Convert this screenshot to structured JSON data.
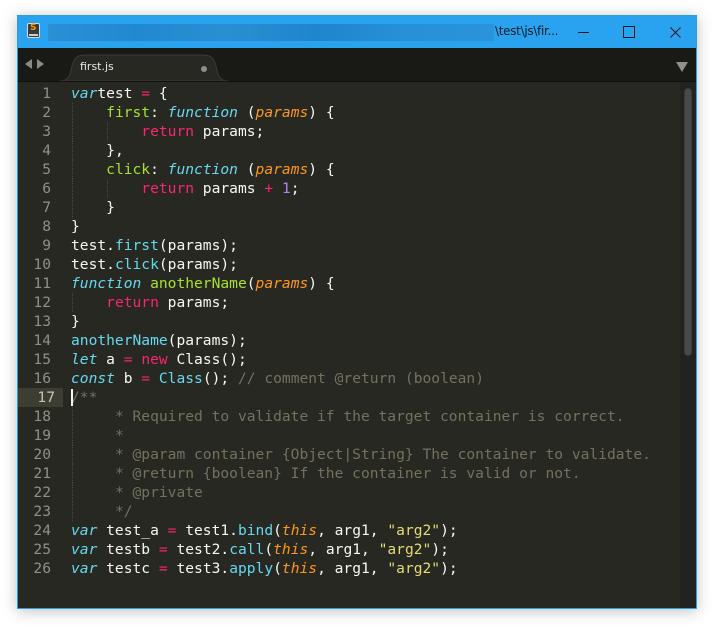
{
  "window": {
    "title_visible": "\\test\\js\\fir...",
    "title_redacted": true,
    "accent_color": "#29a3ef",
    "controls": {
      "minimize_label": "minimize",
      "maximize_label": "maximize",
      "close_label": "close"
    }
  },
  "tabs": [
    {
      "label": "first.js",
      "active": true,
      "dirty": true
    }
  ],
  "editor": {
    "theme": "Monokai",
    "active_line": 17,
    "colors": {
      "background": "#272822",
      "foreground": "#f8f8f2",
      "keyword": "#f92672",
      "storage": "#66d9ef",
      "function": "#a6e22e",
      "parameter": "#fd971f",
      "number": "#ae81ff",
      "string": "#e6db74",
      "comment": "#75715e"
    },
    "lines": [
      {
        "n": "1",
        "indent": 0,
        "tokens": [
          [
            "kw-st",
            "var"
          ],
          [
            "",
            "test "
          ],
          [
            "kw",
            "="
          ],
          [
            "",
            " {"
          ]
        ]
      },
      {
        "n": "2",
        "indent": 1,
        "tokens": [
          [
            "fn",
            "first"
          ],
          [
            "",
            ": "
          ],
          [
            "kw-st",
            "function"
          ],
          [
            "",
            " ("
          ],
          [
            "prm",
            "params"
          ],
          [
            "",
            ") {"
          ]
        ]
      },
      {
        "n": "3",
        "indent": 2,
        "tokens": [
          [
            "kw",
            "return"
          ],
          [
            "",
            " params;"
          ]
        ]
      },
      {
        "n": "4",
        "indent": 1,
        "tokens": [
          [
            "",
            "},"
          ]
        ]
      },
      {
        "n": "5",
        "indent": 1,
        "tokens": [
          [
            "fn",
            "click"
          ],
          [
            "",
            ": "
          ],
          [
            "kw-st",
            "function"
          ],
          [
            "",
            " ("
          ],
          [
            "prm",
            "params"
          ],
          [
            "",
            ") {"
          ]
        ]
      },
      {
        "n": "6",
        "indent": 2,
        "tokens": [
          [
            "kw",
            "return"
          ],
          [
            "",
            " params "
          ],
          [
            "kw",
            "+"
          ],
          [
            "",
            " "
          ],
          [
            "num",
            "1"
          ],
          [
            "",
            ";"
          ]
        ]
      },
      {
        "n": "7",
        "indent": 1,
        "tokens": [
          [
            "",
            "}"
          ]
        ]
      },
      {
        "n": "8",
        "indent": 0,
        "tokens": [
          [
            "",
            "}"
          ]
        ]
      },
      {
        "n": "9",
        "indent": 0,
        "tokens": [
          [
            "",
            "test."
          ],
          [
            "sup",
            "first"
          ],
          [
            "",
            "(params);"
          ]
        ]
      },
      {
        "n": "10",
        "indent": 0,
        "tokens": [
          [
            "",
            "test."
          ],
          [
            "sup",
            "click"
          ],
          [
            "",
            "(params);"
          ]
        ]
      },
      {
        "n": "11",
        "indent": 0,
        "tokens": [
          [
            "kw-st",
            "function"
          ],
          [
            "",
            " "
          ],
          [
            "fn",
            "anotherName"
          ],
          [
            "",
            "("
          ],
          [
            "prm",
            "params"
          ],
          [
            "",
            ") {"
          ]
        ]
      },
      {
        "n": "12",
        "indent": 1,
        "tokens": [
          [
            "kw",
            "return"
          ],
          [
            "",
            " params;"
          ]
        ]
      },
      {
        "n": "13",
        "indent": 0,
        "tokens": [
          [
            "",
            "}"
          ]
        ]
      },
      {
        "n": "14",
        "indent": 0,
        "tokens": [
          [
            "sup",
            "anotherName"
          ],
          [
            "",
            "(params);"
          ]
        ]
      },
      {
        "n": "15",
        "indent": 0,
        "tokens": [
          [
            "kw-st",
            "let"
          ],
          [
            "",
            " a "
          ],
          [
            "kw",
            "="
          ],
          [
            "",
            " "
          ],
          [
            "kw",
            "new"
          ],
          [
            "",
            " Class();"
          ]
        ]
      },
      {
        "n": "16",
        "indent": 0,
        "tokens": [
          [
            "kw-st",
            "const"
          ],
          [
            "",
            " b "
          ],
          [
            "kw",
            "="
          ],
          [
            "",
            " "
          ],
          [
            "sup",
            "Class"
          ],
          [
            "",
            "(); "
          ],
          [
            "cmt",
            "// comment @return (boolean)"
          ]
        ]
      },
      {
        "n": "17",
        "indent": 0,
        "tokens": [
          [
            "cmt",
            "/**"
          ]
        ]
      },
      {
        "n": "18",
        "indent": 1,
        "tokens": [
          [
            "cmt",
            "* Required to validate if the target container is correct."
          ]
        ]
      },
      {
        "n": "19",
        "indent": 1,
        "tokens": [
          [
            "cmt",
            "*"
          ]
        ]
      },
      {
        "n": "20",
        "indent": 1,
        "tokens": [
          [
            "cmt",
            "* @param container {Object|String} The container to validate."
          ]
        ]
      },
      {
        "n": "21",
        "indent": 1,
        "tokens": [
          [
            "cmt",
            "* @return {boolean} If the container is valid or not."
          ]
        ]
      },
      {
        "n": "22",
        "indent": 1,
        "tokens": [
          [
            "cmt",
            "* @private"
          ]
        ]
      },
      {
        "n": "23",
        "indent": 1,
        "tokens": [
          [
            "cmt",
            "*/"
          ]
        ]
      },
      {
        "n": "24",
        "indent": 0,
        "tokens": [
          [
            "kw-st",
            "var"
          ],
          [
            "",
            " test_a "
          ],
          [
            "kw",
            "="
          ],
          [
            "",
            " test1."
          ],
          [
            "sup",
            "bind"
          ],
          [
            "",
            "("
          ],
          [
            "this",
            "this"
          ],
          [
            "",
            ", arg1, "
          ],
          [
            "str",
            "\"arg2\""
          ],
          [
            "",
            ");"
          ]
        ]
      },
      {
        "n": "25",
        "indent": 0,
        "tokens": [
          [
            "kw-st",
            "var"
          ],
          [
            "",
            " testb "
          ],
          [
            "kw",
            "="
          ],
          [
            "",
            " test2."
          ],
          [
            "sup",
            "call"
          ],
          [
            "",
            "("
          ],
          [
            "this",
            "this"
          ],
          [
            "",
            ", arg1, "
          ],
          [
            "str",
            "\"arg2\""
          ],
          [
            "",
            ");"
          ]
        ]
      },
      {
        "n": "26",
        "indent": 0,
        "tokens": [
          [
            "kw-st",
            "var"
          ],
          [
            "",
            " testc "
          ],
          [
            "kw",
            "="
          ],
          [
            "",
            " test3."
          ],
          [
            "sup",
            "apply"
          ],
          [
            "",
            "("
          ],
          [
            "this",
            "this"
          ],
          [
            "",
            ", arg1, "
          ],
          [
            "str",
            "\"arg2\""
          ],
          [
            "",
            ");"
          ]
        ]
      }
    ]
  }
}
